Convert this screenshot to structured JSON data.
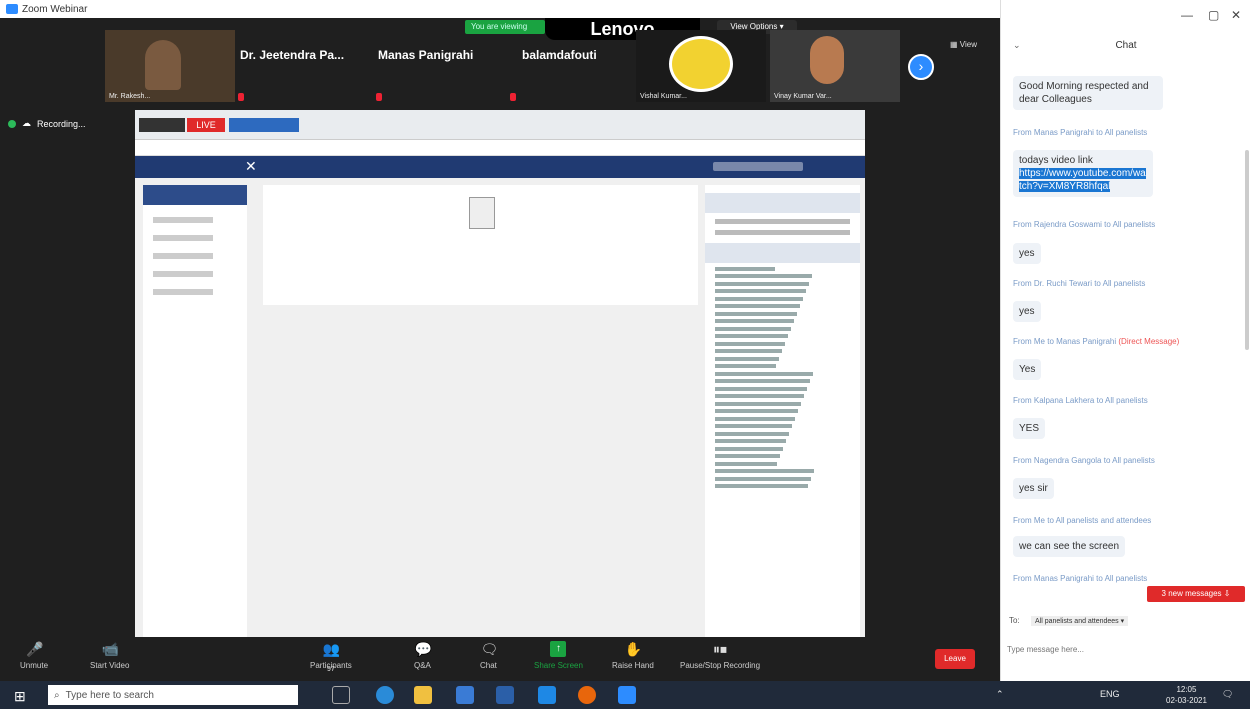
{
  "window": {
    "title": "Zoom Webinar",
    "minimize": "—",
    "maximize": "▢",
    "close": "✕"
  },
  "banner": {
    "talking": "You are viewing",
    "brand": "Lenovo",
    "view_options": "View Options ▾",
    "view": "View"
  },
  "participants": [
    {
      "name": "Mr. Rakesh...",
      "mic_off": false
    },
    {
      "name": "Dr. Jeetendra Pa...",
      "mic_off": true
    },
    {
      "name": "Manas Panigrahi",
      "mic_off": true
    },
    {
      "name": "balamdafouti",
      "mic_off": true
    },
    {
      "name": "Vishal Kumar...",
      "mic_off": true
    },
    {
      "name": "Vinay Kumar Var...",
      "mic_off": true
    }
  ],
  "recording": {
    "label": "Recording..."
  },
  "shared": {
    "live": "LIVE"
  },
  "toolbar": {
    "unmute": "Unmute",
    "start_video": "Start Video",
    "participants": "Participants",
    "participants_count": "97",
    "qa": "Q&A",
    "chat": "Chat",
    "share_screen": "Share Screen",
    "raise_hand": "Raise Hand",
    "pause_recording": "Pause/Stop Recording",
    "leave": "Leave"
  },
  "chat": {
    "title": "Chat",
    "messages": [
      {
        "from": "",
        "text": "Good Morning respected and dear Colleagues"
      },
      {
        "from": "From Manas Panigrahi to All panelists",
        "text": "todays video link"
      },
      {
        "from": "From Rajendra Goswami to All panelists",
        "text": "yes"
      },
      {
        "from": "From Dr. Ruchi Tewari to All panelists",
        "text": "yes"
      },
      {
        "from": "From Me to Manas Panigrahi",
        "dm": "(Direct Message)",
        "text": "Yes"
      },
      {
        "from": "From Kalpana Lakhera to All panelists",
        "text": "YES"
      },
      {
        "from": "From Nagendra Gangola to All panelists",
        "text": "yes sir"
      },
      {
        "from": "From Me to All panelists and attendees",
        "text": "we can see the screen"
      },
      {
        "from": "From Manas Panigrahi to All panelists",
        "text": ""
      }
    ],
    "link": "https://www.youtube.com/watch?v=XM8YR8hfqal",
    "new_messages": "3 new messages ⇩",
    "to_label": "To:",
    "to_value": "All panelists and attendees ▾",
    "input_placeholder": "Type message here..."
  },
  "taskbar": {
    "search_placeholder": "Type here to search",
    "lang": "ENG",
    "time": "12:05",
    "date": "02-03-2021"
  }
}
